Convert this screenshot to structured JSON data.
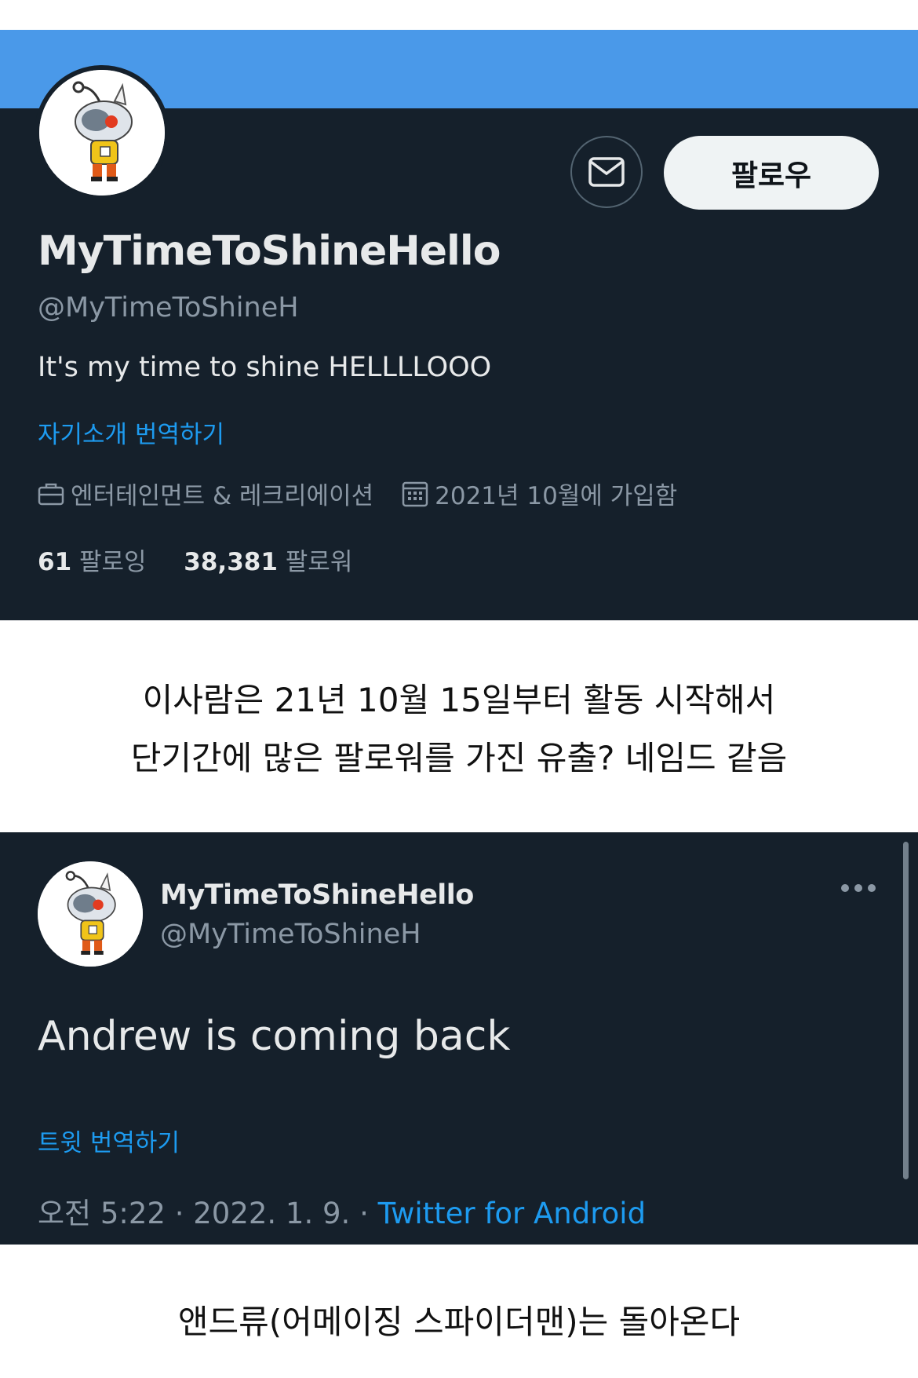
{
  "colors": {
    "panel_bg": "#15202b",
    "banner": "#4a99e9",
    "primary_text": "#e7e9ea",
    "secondary_text": "#8b98a5",
    "link": "#1d9bf0",
    "follow_button_bg": "#eff3f4"
  },
  "profile": {
    "avatar_icon": "robot-mascot-avatar",
    "dm_icon": "mail-icon",
    "follow_label": "팔로우",
    "display_name": "MyTimeToShineHello",
    "handle": "@MyTimeToShineH",
    "bio": "It's my time to shine HELLLLOOO",
    "translate_bio": "자기소개 번역하기",
    "category_icon": "briefcase-icon",
    "category": "엔터테인먼트 & 레크리에이션",
    "joined_icon": "calendar-icon",
    "joined": "2021년 10월에 가입함",
    "following_count": "61",
    "following_label": "팔로잉",
    "followers_count": "38,381",
    "followers_label": "팔로워"
  },
  "captions": {
    "line1": "이사람은 21년 10월 15일부터 활동 시작해서",
    "line2": "단기간에 많은 팔로워를 가진 유출? 네임드 같음",
    "line3": "앤드류(어메이징 스파이더맨)는 돌아온다"
  },
  "tweet": {
    "avatar_icon": "robot-mascot-avatar",
    "display_name": "MyTimeToShineHello",
    "handle": "@MyTimeToShineH",
    "more_icon": "more-horizontal-icon",
    "text": "Andrew is coming back",
    "translate": "트윗 번역하기",
    "time": "오전 5:22",
    "date": "2022. 1. 9.",
    "source": "Twitter for Android"
  }
}
